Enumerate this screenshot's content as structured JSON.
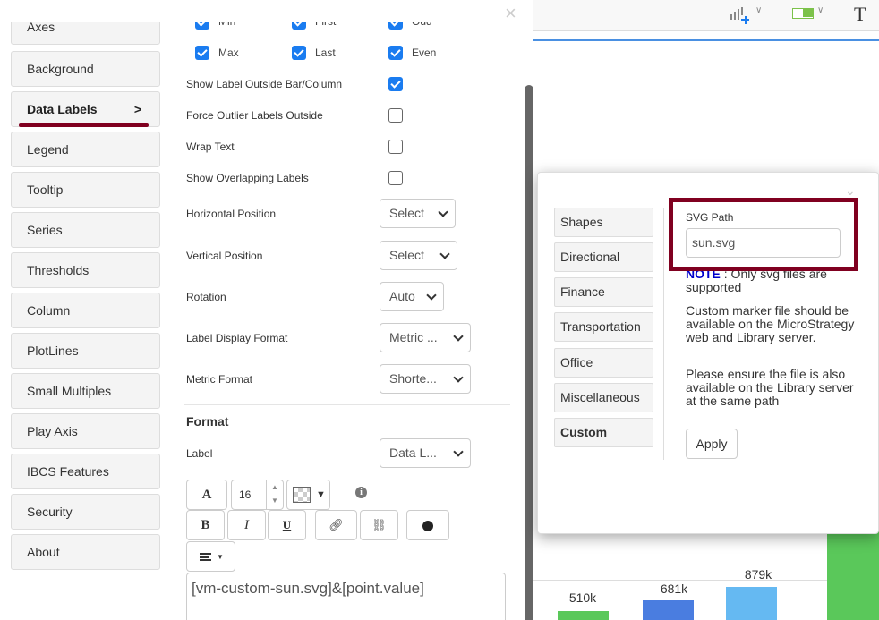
{
  "sidebar": {
    "items": [
      {
        "label": "Axes"
      },
      {
        "label": "Background"
      },
      {
        "label": "Data Labels",
        "active": true,
        "chevron": ">"
      },
      {
        "label": "Legend"
      },
      {
        "label": "Tooltip"
      },
      {
        "label": "Series"
      },
      {
        "label": "Thresholds"
      },
      {
        "label": "Column"
      },
      {
        "label": "PlotLines"
      },
      {
        "label": "Small Multiples"
      },
      {
        "label": "Play Axis"
      },
      {
        "label": "IBCS Features"
      },
      {
        "label": "Security"
      },
      {
        "label": "About"
      }
    ]
  },
  "panel": {
    "close": "×",
    "checks_row1": [
      {
        "label": "Min",
        "checked": true
      },
      {
        "label": "First",
        "checked": true
      },
      {
        "label": "Odd",
        "checked": true
      }
    ],
    "checks_row2": [
      {
        "label": "Max",
        "checked": true
      },
      {
        "label": "Last",
        "checked": true
      },
      {
        "label": "Even",
        "checked": true
      }
    ],
    "options": [
      {
        "label": "Show Label Outside Bar/Column",
        "checked": true
      },
      {
        "label": "Force Outlier Labels Outside",
        "checked": false
      },
      {
        "label": "Wrap Text",
        "checked": false
      },
      {
        "label": "Show Overlapping Labels",
        "checked": false
      }
    ],
    "dropdowns": [
      {
        "label": "Horizontal Position",
        "value": "Select"
      },
      {
        "label": "Vertical Position",
        "value": "Select"
      },
      {
        "label": "Rotation",
        "value": "Auto"
      },
      {
        "label": "Label Display Format",
        "value": "Metric ..."
      },
      {
        "label": "Metric Format",
        "value": "Shorte..."
      }
    ],
    "format_heading": "Format",
    "label_field": {
      "label": "Label",
      "value": "Data L..."
    },
    "toolbar": {
      "font": "A",
      "size": "16",
      "bold": "B",
      "italic": "I",
      "underline": "U"
    },
    "editor_text": "[vm-custom-sun.svg]&[point.value]"
  },
  "popup": {
    "tabs": [
      {
        "label": "Shapes"
      },
      {
        "label": "Directional"
      },
      {
        "label": "Finance"
      },
      {
        "label": "Transportation"
      },
      {
        "label": "Office"
      },
      {
        "label": "Miscellaneous"
      },
      {
        "label": "Custom",
        "active": true
      }
    ],
    "svg_path_label": "SVG Path",
    "svg_path_value": "sun.svg",
    "note_label": "NOTE",
    "note_text": " : Only svg files are supported",
    "info1": "Custom marker file should be available on the MicroStrategy web and Library server.",
    "info2": "Please ensure the file is also available on the Library server at the same path",
    "apply": "Apply",
    "highlight_color": "#800020"
  },
  "toolbar_top": {
    "text_icon": "T"
  },
  "chart": {
    "bars": [
      {
        "label": "510k",
        "color": "#5ac85a"
      },
      {
        "label": "681k",
        "color": "#4a7de0"
      },
      {
        "label": "879k",
        "color": "#65b9f2"
      },
      {
        "label": "",
        "color": "#5ac85a"
      }
    ]
  }
}
